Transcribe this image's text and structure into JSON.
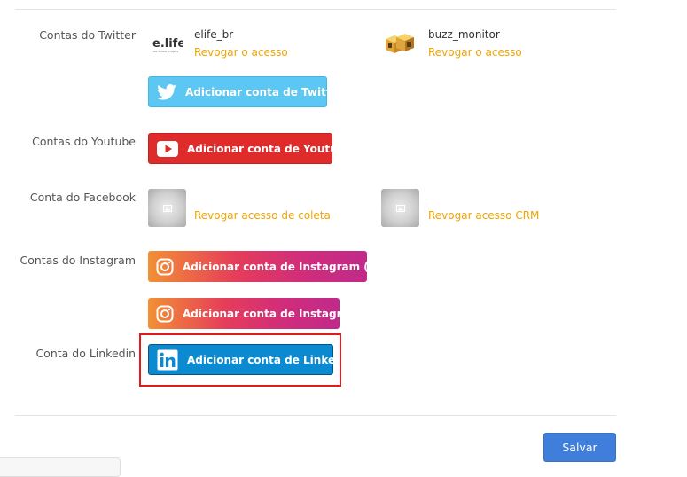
{
  "twitter": {
    "label": "Contas do Twitter",
    "accounts": [
      {
        "name": "elife_br",
        "revoke": "Revogar o acesso",
        "logo": "e.life",
        "logo_tag": "we deliver insights"
      },
      {
        "name": "buzz_monitor",
        "revoke": "Revogar o acesso",
        "logo": "buzz-monitor-logo"
      }
    ],
    "add_button": "Adicionar conta de Twitter"
  },
  "youtube": {
    "label": "Contas do Youtube",
    "add_button": "Adicionar conta de Youtube"
  },
  "facebook": {
    "label": "Conta do Facebook",
    "revoke_collection": "Revogar acesso de coleta",
    "revoke_crm": "Revogar acesso CRM"
  },
  "instagram": {
    "label": "Contas do Instagram",
    "add_crm_button": "Adicionar conta de Instagram (crm)",
    "add_button": "Adicionar conta de Instagram"
  },
  "linkedin": {
    "label": "Conta do Linkedin",
    "add_button": "Adicionar conta de Linkedin"
  },
  "footer": {
    "save_label": "Salvar"
  },
  "colors": {
    "accent_orange": "#f0a400",
    "twitter": "#5bc7f2",
    "youtube": "#e02b2b",
    "linkedin": "#0b8ad2",
    "save": "#3f7fdb",
    "highlight": "#e11a1a"
  }
}
